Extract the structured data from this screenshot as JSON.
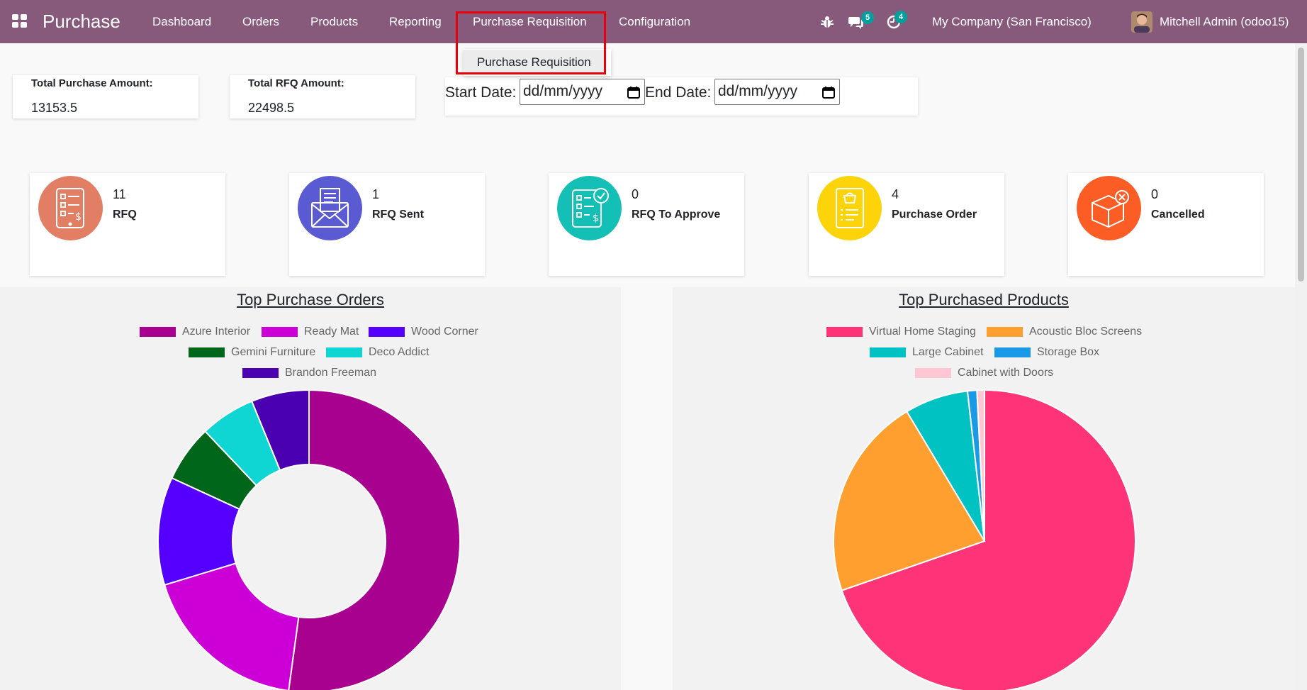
{
  "navbar": {
    "brand": "Purchase",
    "menu": [
      {
        "label": "Dashboard"
      },
      {
        "label": "Orders"
      },
      {
        "label": "Products"
      },
      {
        "label": "Reporting"
      },
      {
        "label": "Purchase Requisition"
      },
      {
        "label": "Configuration"
      }
    ],
    "dropdown_item": "Purchase Requisition",
    "messages_badge": "5",
    "activities_badge": "4",
    "company": "My Company (San Francisco)",
    "user": "Mitchell Admin (odoo15)",
    "color": "#875a7b",
    "icons": [
      "apps-grid-icon",
      "bug-icon",
      "chat-icon",
      "clock-icon"
    ]
  },
  "summary": {
    "total_purchase_label": "Total Purchase Amount:",
    "total_purchase_value": "13153.5",
    "total_rfq_label": "Total RFQ Amount:",
    "total_rfq_value": "22498.5"
  },
  "date_filter": {
    "start_label": "Start Date:",
    "start_value": "dd/mm/yyyy",
    "end_label": "End Date:",
    "end_value": "dd/mm/yyyy"
  },
  "stats": [
    {
      "count": "11",
      "label": "RFQ",
      "color": "#e27e63",
      "icon": "rfq-document-icon"
    },
    {
      "count": "1",
      "label": "RFQ Sent",
      "color": "#5a5bd2",
      "icon": "envelope-icon"
    },
    {
      "count": "0",
      "label": "RFQ To Approve",
      "color": "#14c0b5",
      "icon": "approve-check-icon"
    },
    {
      "count": "4",
      "label": "Purchase Order",
      "color": "#fdd30a",
      "icon": "basket-list-icon"
    },
    {
      "count": "0",
      "label": "Cancelled",
      "color": "#fb5d25",
      "icon": "cancelled-box-icon"
    }
  ],
  "chart_data": [
    {
      "type": "doughnut",
      "title": "Top Purchase Orders",
      "legend": "top",
      "series": [
        {
          "name": "Azure Interior",
          "value": 50.6,
          "color": "#a8008f"
        },
        {
          "name": "Ready Mat",
          "value": 17.6,
          "color": "#cc00d6"
        },
        {
          "name": "Wood Corner",
          "value": 11.2,
          "color": "#5500ff"
        },
        {
          "name": "Gemini Furniture",
          "value": 5.9,
          "color": "#006619"
        },
        {
          "name": "Deco Addict",
          "value": 5.7,
          "color": "#0fd6d2"
        },
        {
          "name": "Brandon Freeman",
          "value": 6.0,
          "color": "#4a00b1"
        }
      ]
    },
    {
      "type": "pie",
      "title": "Top Purchased Products",
      "legend": "top",
      "series": [
        {
          "name": "Virtual Home Staging",
          "value": 69.7,
          "color": "#ff3377"
        },
        {
          "name": "Acoustic Bloc Screens",
          "value": 21.7,
          "color": "#ff9f30"
        },
        {
          "name": "Large Cabinet",
          "value": 6.8,
          "color": "#00c2c2"
        },
        {
          "name": "Storage Box",
          "value": 1.0,
          "color": "#1a99e6"
        },
        {
          "name": "Cabinet with Doors",
          "value": 0.8,
          "color": "#ffc7d4"
        }
      ]
    }
  ]
}
